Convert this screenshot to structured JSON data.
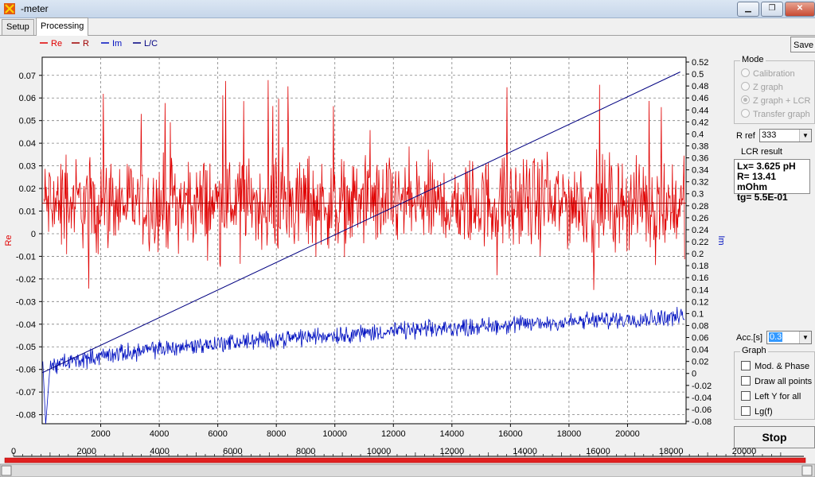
{
  "window": {
    "title": "-meter",
    "minimize": "▁",
    "maximize": "❐",
    "close": "✕"
  },
  "tabs": [
    {
      "label": "Setup"
    },
    {
      "label": "Processing"
    }
  ],
  "toolbar": {
    "save_label": "Save"
  },
  "mode": {
    "title": "Mode",
    "options": [
      {
        "label": "Calibration",
        "selected": false
      },
      {
        "label": "Z graph",
        "selected": false
      },
      {
        "label": "Z graph + LCR",
        "selected": true
      },
      {
        "label": "Transfer graph",
        "selected": false
      }
    ]
  },
  "rref": {
    "label": "R ref",
    "value": "333"
  },
  "lcr": {
    "title": "LCR result",
    "lines": [
      "Lx= 3.625 pH",
      "R= 13.41 mOhm",
      "tg= 5.5E-01"
    ]
  },
  "acc": {
    "label": "Acc.[s]",
    "value": "0.3"
  },
  "graph_opts": {
    "title": "Graph",
    "items": [
      {
        "label": "Mod. & Phase",
        "checked": false
      },
      {
        "label": "Draw all points",
        "checked": false
      },
      {
        "label": "Left Y for all",
        "checked": false
      },
      {
        "label": "Lg(f)",
        "checked": false
      }
    ]
  },
  "stop": {
    "label": "Stop"
  },
  "colors": {
    "re": "#e00000",
    "r": "#a00000",
    "im": "#0010c0",
    "lc": "#000080"
  },
  "chart_data": {
    "type": "line",
    "legend": [
      {
        "name": "Re",
        "color": "#e00000"
      },
      {
        "name": "R",
        "color": "#a00000"
      },
      {
        "name": "Im",
        "color": "#0010c0"
      },
      {
        "name": "L/C",
        "color": "#000080"
      }
    ],
    "xlim": [
      0,
      22000
    ],
    "xticks": [
      2000,
      4000,
      6000,
      8000,
      10000,
      12000,
      14000,
      16000,
      18000,
      20000
    ],
    "y_left": {
      "label": "Re",
      "range": [
        -0.084,
        0.078
      ],
      "ticks": [
        "0.07",
        "0.06",
        "0.05",
        "0.04",
        "0.03",
        "0.02",
        "0.01",
        "0",
        "-0.01",
        "-0.02",
        "-0.03",
        "-0.04",
        "-0.05",
        "-0.06",
        "-0.07",
        "-0.08"
      ]
    },
    "y_right": {
      "label": "Im",
      "range": [
        -0.084,
        0.528
      ],
      "ticks": [
        "0.52",
        "0.5",
        "0.48",
        "0.46",
        "0.44",
        "0.42",
        "0.4",
        "0.38",
        "0.36",
        "0.34",
        "0.32",
        "0.3",
        "0.28",
        "0.26",
        "0.24",
        "0.22",
        "0.2",
        "0.18",
        "0.16",
        "0.14",
        "0.12",
        "0.1",
        "0.08",
        "0.06",
        "0.04",
        "0.02",
        "0",
        "-0.02",
        "-0.04",
        "-0.06",
        "-0.08"
      ]
    },
    "grid": true,
    "series": [
      {
        "name": "Re",
        "axis": "left",
        "mean": 0.0135,
        "noise": 0.014,
        "spikes": 0.055
      },
      {
        "name": "R",
        "axis": "left",
        "constant": 0.0135
      },
      {
        "name": "Im",
        "axis": "right",
        "start": 0.0,
        "end": 0.095,
        "noise": 0.012
      },
      {
        "name": "L/C",
        "axis": "left",
        "line": [
          [
            0,
            -0.0615
          ],
          [
            21800,
            0.0715
          ]
        ]
      }
    ]
  },
  "bottom_scale": {
    "ticks": [
      "0",
      "2000",
      "4000",
      "6000",
      "8000",
      "10000",
      "12000",
      "14000",
      "16000",
      "18000",
      "20000"
    ],
    "range": [
      0,
      20000
    ]
  }
}
